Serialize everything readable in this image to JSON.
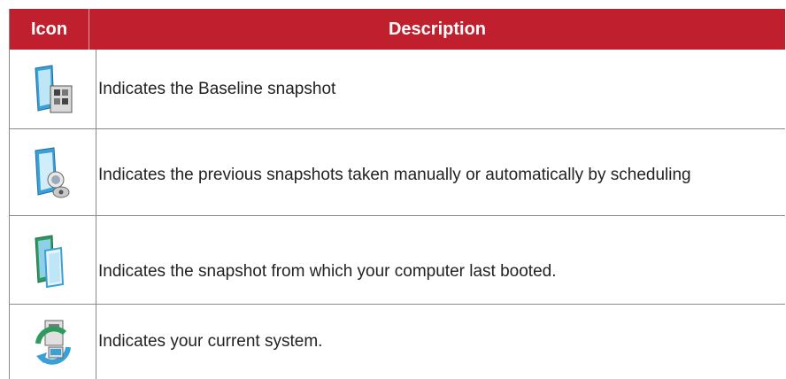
{
  "table": {
    "headers": {
      "icon": "Icon",
      "description": "Description"
    },
    "rows": [
      {
        "icon": "baseline-snapshot-icon",
        "description": "Indicates the Baseline snapshot"
      },
      {
        "icon": "previous-snapshot-icon",
        "description": "Indicates the previous snapshots taken manually or automatically by scheduling"
      },
      {
        "icon": "last-booted-snapshot-icon",
        "description": "Indicates the snapshot from which your computer last booted."
      },
      {
        "icon": "current-system-icon",
        "description": "Indicates your current system."
      }
    ]
  },
  "colors": {
    "header_bg": "#c0202e",
    "header_text": "#ffffff",
    "border": "#8a8a8a"
  }
}
